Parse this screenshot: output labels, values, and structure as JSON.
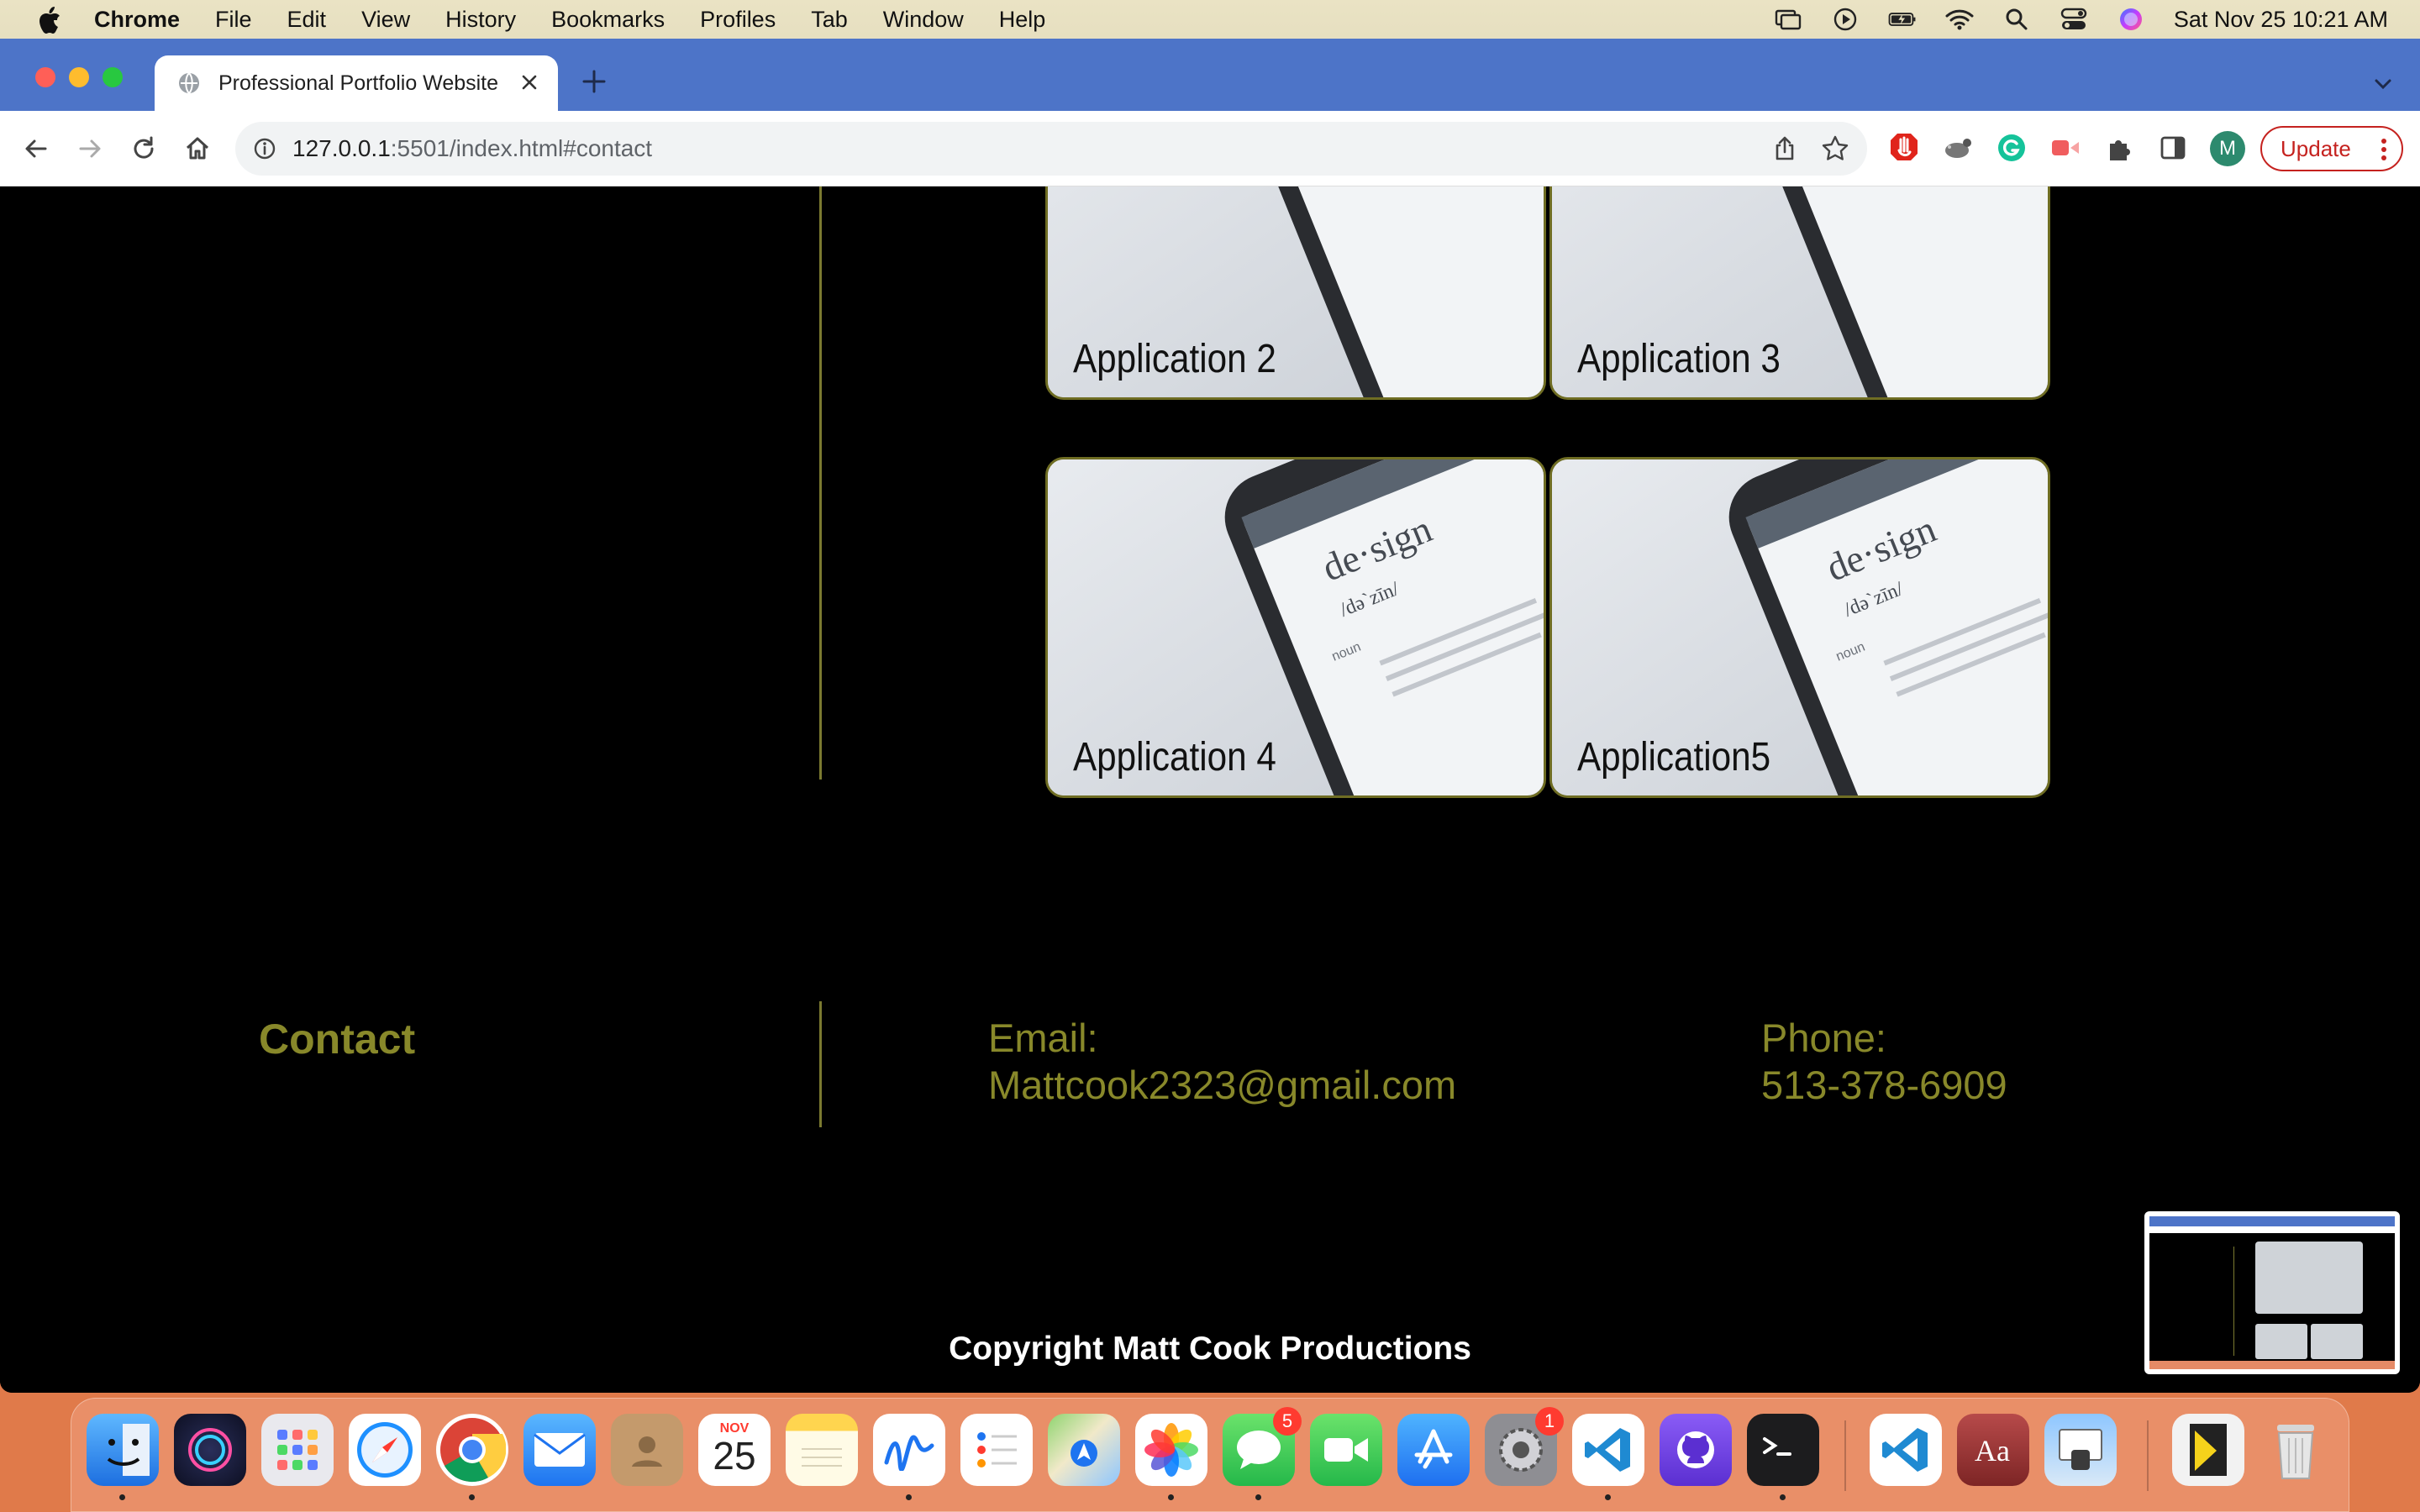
{
  "menubar": {
    "app_name": "Chrome",
    "items": [
      "File",
      "Edit",
      "View",
      "History",
      "Bookmarks",
      "Profiles",
      "Tab",
      "Window",
      "Help"
    ],
    "clock": "Sat Nov 25  10:21 AM"
  },
  "browser": {
    "tab_title": "Professional Portfolio Website",
    "url_host": "127.0.0.1",
    "url_rest": ":5501/index.html#contact",
    "avatar_letter": "M",
    "update_label": "Update"
  },
  "portfolio": {
    "cards": [
      {
        "label": "Application 2"
      },
      {
        "label": "Application 3"
      },
      {
        "label": "Application 4"
      },
      {
        "label": "Application5"
      }
    ],
    "card_image_text": {
      "word": "de·sign",
      "pron": "/də`zīn/",
      "pos": "noun"
    }
  },
  "contact": {
    "heading": "Contact",
    "email_label": "Email:",
    "email_value": "Mattcook2323@gmail.com",
    "phone_label": "Phone:",
    "phone_value": "513-378-6909"
  },
  "footer": {
    "copyright": "Copyright Matt Cook Productions"
  },
  "dock": {
    "calendar_month": "NOV",
    "calendar_day": "25",
    "messages_badge": "5",
    "settings_badge": "1"
  },
  "colors": {
    "accent_olive": "#88882a",
    "card_border": "#6f6d23",
    "tabstrip": "#4d74c8",
    "update_red": "#c5221f"
  }
}
